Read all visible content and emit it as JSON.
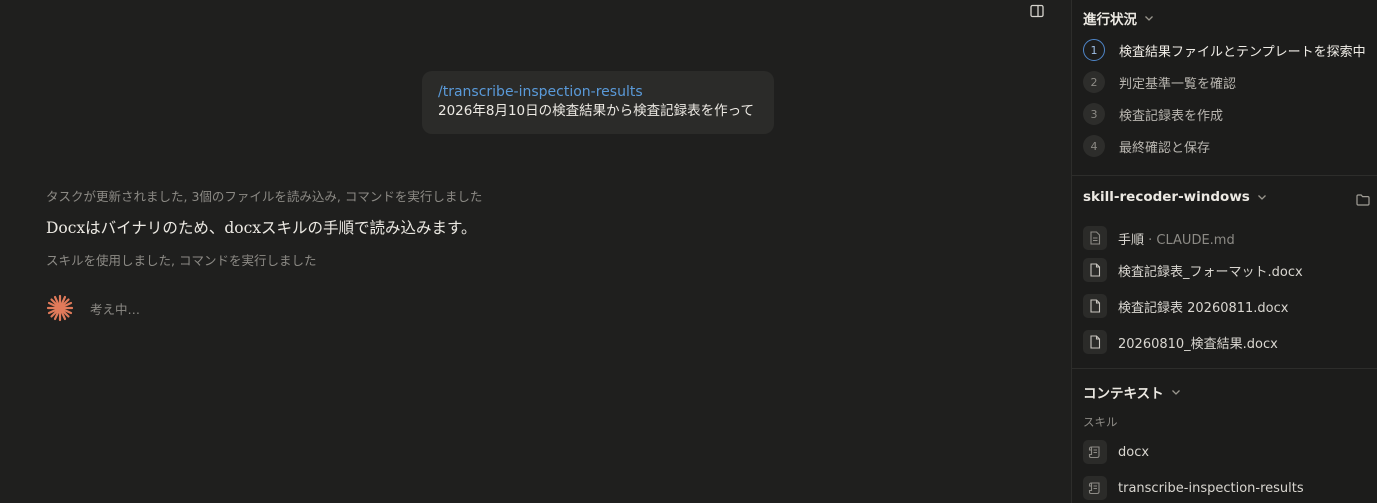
{
  "main": {
    "user_message": {
      "command": "/transcribe-inspection-results",
      "text": "2026年8月10日の検査結果から検査記録表を作って"
    },
    "activity_summary_1": "タスクが更新されました, 3個のファイルを読み込み, コマンドを実行しました",
    "assistant_text": "Docxはバイナリのため、docxスキルの手順で読み込みます。",
    "activity_summary_2": "スキルを使用しました, コマンドを実行しました",
    "thinking_label": "考え中…",
    "accent_color": "#e07a5a"
  },
  "sidebar": {
    "progress": {
      "title": "進行状況",
      "steps": [
        {
          "number": "1",
          "label": "検査結果ファイルとテンプレートを探索中",
          "active": true
        },
        {
          "number": "2",
          "label": "判定基準一覧を確認",
          "active": false
        },
        {
          "number": "3",
          "label": "検査記録表を作成",
          "active": false
        },
        {
          "number": "4",
          "label": "最終確認と保存",
          "active": false
        }
      ]
    },
    "folder": {
      "title": "skill-recoder-windows",
      "files": [
        {
          "name": "手順",
          "suffix": " · CLAUDE.md"
        },
        {
          "name": "検査記録表_フォーマット.docx"
        },
        {
          "name": "検査記録表 20260811.docx"
        },
        {
          "name": "20260810_検査結果.docx"
        }
      ]
    },
    "context": {
      "title": "コンテキスト",
      "subheading": "スキル",
      "skills": [
        {
          "name": "docx"
        },
        {
          "name": "transcribe-inspection-results"
        }
      ]
    }
  }
}
